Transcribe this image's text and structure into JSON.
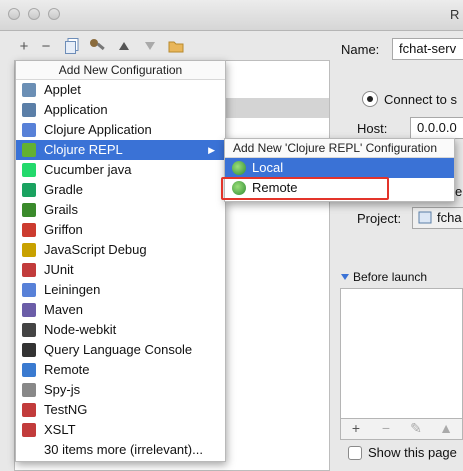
{
  "window": {
    "title": "R"
  },
  "toolbar": {
    "add_icon": "+",
    "remove_icon": "−"
  },
  "menu": {
    "header": "Add New Configuration",
    "items": [
      {
        "label": "Applet",
        "icon": "applet-icon",
        "icon_color": "#6b8fb5"
      },
      {
        "label": "Application",
        "icon": "application-icon",
        "icon_color": "#5b7fa8"
      },
      {
        "label": "Clojure Application",
        "icon": "clojure-icon",
        "icon_color": "#5881d8"
      },
      {
        "label": "Clojure REPL",
        "icon": "clojure-repl-icon",
        "icon_color": "#63b132",
        "selected": true,
        "has_submenu": true
      },
      {
        "label": "Cucumber java",
        "icon": "cucumber-icon",
        "icon_color": "#23d96c"
      },
      {
        "label": "Gradle",
        "icon": "gradle-icon",
        "icon_color": "#1aa260"
      },
      {
        "label": "Grails",
        "icon": "grails-icon",
        "icon_color": "#3a8a2b"
      },
      {
        "label": "Griffon",
        "icon": "griffon-icon",
        "icon_color": "#cc3b2f"
      },
      {
        "label": "JavaScript Debug",
        "icon": "javascript-debug-icon",
        "icon_color": "#c8a100"
      },
      {
        "label": "JUnit",
        "icon": "junit-icon",
        "icon_color": "#c23b3b"
      },
      {
        "label": "Leiningen",
        "icon": "leiningen-icon",
        "icon_color": "#5881d8"
      },
      {
        "label": "Maven",
        "icon": "maven-icon",
        "icon_color": "#6b5da8"
      },
      {
        "label": "Node-webkit",
        "icon": "node-webkit-icon",
        "icon_color": "#444444"
      },
      {
        "label": "Query Language Console",
        "icon": "query-console-icon",
        "icon_color": "#333333"
      },
      {
        "label": "Remote",
        "icon": "remote-icon",
        "icon_color": "#3a7ad0"
      },
      {
        "label": "Spy-js",
        "icon": "spy-js-icon",
        "icon_color": "#888888"
      },
      {
        "label": "TestNG",
        "icon": "testng-icon",
        "icon_color": "#c23b3b"
      },
      {
        "label": "XSLT",
        "icon": "xslt-icon",
        "icon_color": "#c23b3b"
      },
      {
        "label": "30 items more (irrelevant)...",
        "icon": "",
        "icon_color": ""
      }
    ]
  },
  "submenu": {
    "header": "Add New 'Clojure REPL' Configuration",
    "items": [
      {
        "label": "Local",
        "icon": "clojure-repl-local-icon",
        "selected": true
      },
      {
        "label": "Remote",
        "icon": "clojure-repl-remote-icon",
        "selected": false
      }
    ]
  },
  "form": {
    "name_label": "Name:",
    "name_value": "fchat-serv",
    "connect_label": "Connect to s",
    "host_label": "Host:",
    "host_value": "0.0.0.0",
    "project_label": "Project:",
    "project_value": "fcha",
    "partial_e": "e",
    "before_launch_label": "Before launch",
    "show_page_label": "Show this page"
  },
  "colors": {
    "selection": "#3a72d6",
    "highlight_border": "#e3342a"
  }
}
